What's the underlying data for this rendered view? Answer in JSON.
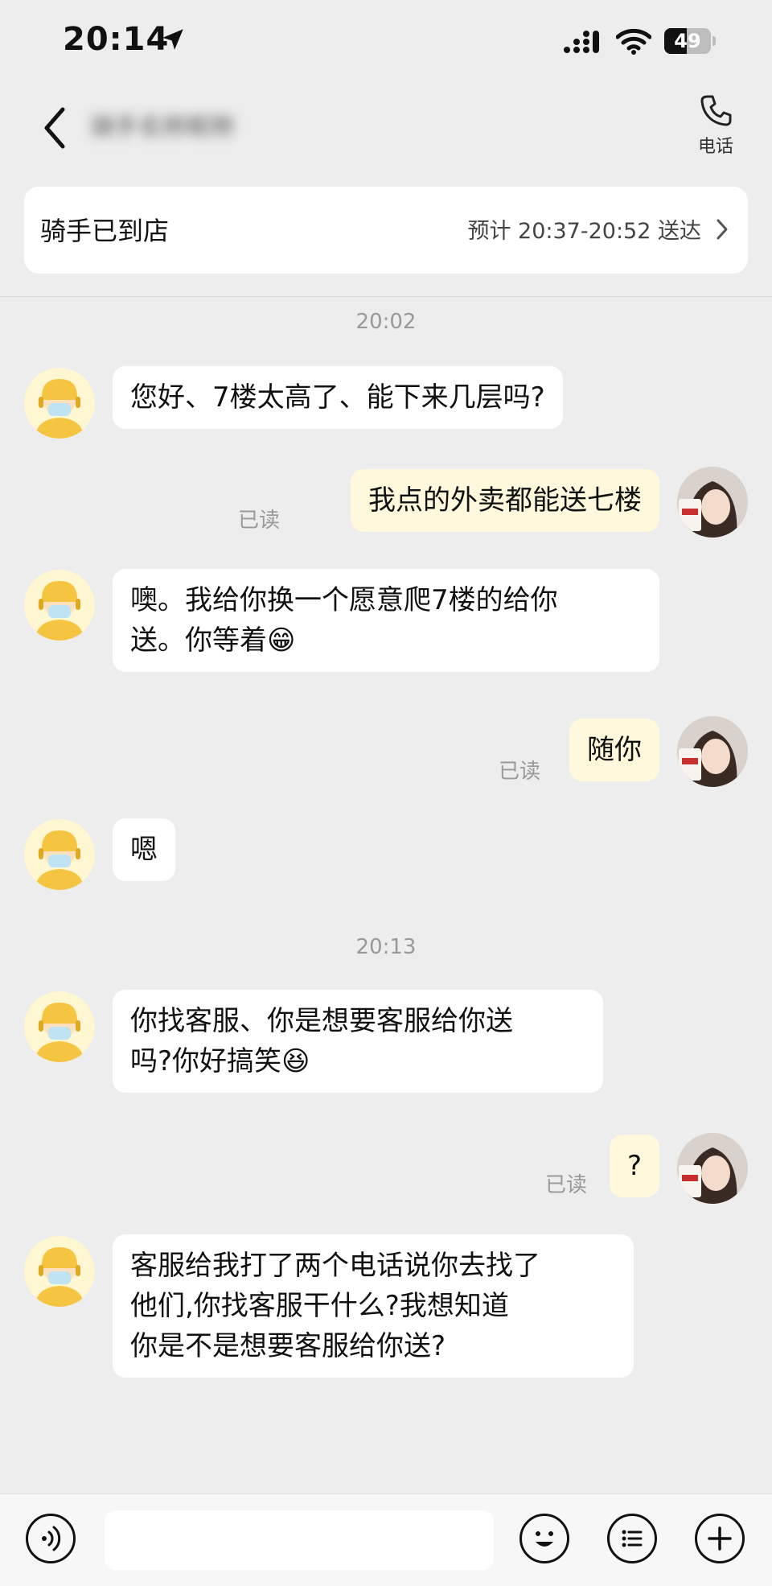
{
  "status_bar": {
    "time": "20:14",
    "battery_level": "49",
    "icons": [
      "location-arrow-icon",
      "signal-icon",
      "wifi-icon",
      "battery-icon"
    ]
  },
  "nav": {
    "back_icon": "chevron-left-icon",
    "contact_name": "骑手名称昵称",
    "call_label": "电话"
  },
  "order_status": {
    "title": "骑手已到店",
    "eta": "预计 20:37-20:52 送达"
  },
  "chat": {
    "timestamps": [
      "20:02",
      "20:13"
    ],
    "read_label": "已读",
    "messages": [
      {
        "from": "rider",
        "lines": [
          "您好、7楼太高了、能下来几层吗?"
        ]
      },
      {
        "from": "user",
        "lines": [
          "我点的外卖都能送七楼"
        ]
      },
      {
        "from": "rider",
        "lines": [
          "噢。我给你换一个愿意爬7楼的给你",
          "送。你等着"
        ],
        "emoji": "😁"
      },
      {
        "from": "user",
        "lines": [
          "随你"
        ]
      },
      {
        "from": "rider",
        "lines": [
          "嗯"
        ]
      },
      {
        "from": "rider",
        "lines": [
          "你找客服、你是想要客服给你送",
          "吗?你好搞笑"
        ],
        "emoji": "😆"
      },
      {
        "from": "user",
        "lines": [
          "?"
        ]
      },
      {
        "from": "rider",
        "lines": [
          "客服给我打了两个电话说你去找了",
          "他们,你找客服干什么?我想知道",
          "你是不是想要客服给你送?"
        ]
      }
    ]
  },
  "input_bar": {
    "placeholder": "",
    "icons": [
      "voice-icon",
      "emoji-icon",
      "quick-reply-icon",
      "plus-icon"
    ]
  },
  "colors": {
    "background": "#ededed",
    "incoming_bubble": "#ffffff",
    "outgoing_bubble": "#fff8dc",
    "rider_accent": "#f5c542"
  }
}
